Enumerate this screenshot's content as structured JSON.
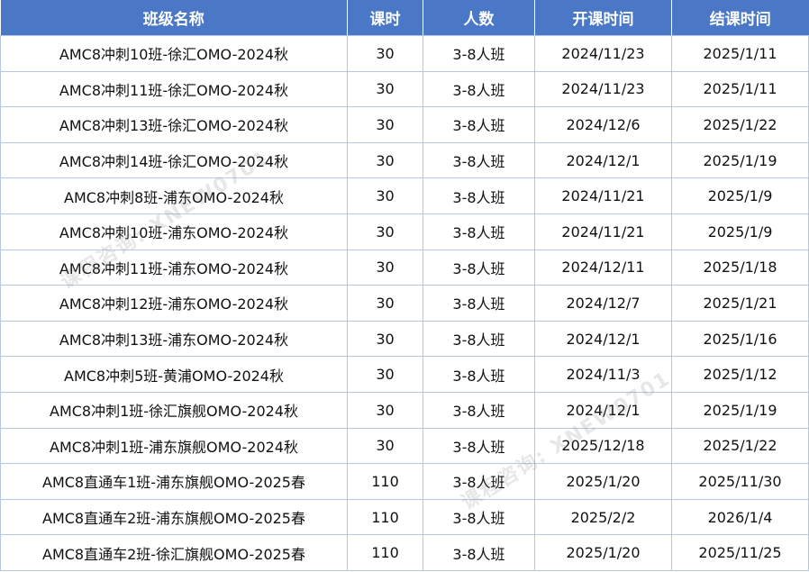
{
  "table": {
    "headers": [
      "班级名称",
      "课时",
      "人数",
      "开课时间",
      "结课时间"
    ],
    "rows": [
      [
        "AMC8冲刺10班-徐汇OMO-2024秋",
        "30",
        "3-8人班",
        "2024/11/23",
        "2025/1/11"
      ],
      [
        "AMC8冲刺11班-徐汇OMO-2024秋",
        "30",
        "3-8人班",
        "2024/11/23",
        "2025/1/11"
      ],
      [
        "AMC8冲刺13班-徐汇OMO-2024秋",
        "30",
        "3-8人班",
        "2024/12/6",
        "2025/1/22"
      ],
      [
        "AMC8冲刺14班-徐汇OMO-2024秋",
        "30",
        "3-8人班",
        "2024/12/1",
        "2025/1/19"
      ],
      [
        "AMC8冲刺8班-浦东OMO-2024秋",
        "30",
        "3-8人班",
        "2024/11/21",
        "2025/1/9"
      ],
      [
        "AMC8冲刺10班-浦东OMO-2024秋",
        "30",
        "3-8人班",
        "2024/11/21",
        "2025/1/9"
      ],
      [
        "AMC8冲刺11班-浦东OMO-2024秋",
        "30",
        "3-8人班",
        "2024/12/11",
        "2025/1/18"
      ],
      [
        "AMC8冲刺12班-浦东OMO-2024秋",
        "30",
        "3-8人班",
        "2024/12/7",
        "2025/1/21"
      ],
      [
        "AMC8冲刺13班-浦东OMO-2024秋",
        "30",
        "3-8人班",
        "2024/12/1",
        "2025/1/16"
      ],
      [
        "AMC8冲刺5班-黄浦OMO-2024秋",
        "30",
        "3-8人班",
        "2024/11/3",
        "2025/1/12"
      ],
      [
        "AMC8冲刺1班-徐汇旗舰OMO-2024秋",
        "30",
        "3-8人班",
        "2024/12/1",
        "2025/1/19"
      ],
      [
        "AMC8冲刺1班-浦东旗舰OMO-2024秋",
        "30",
        "3-8人班",
        "2025/12/18",
        "2025/1/22"
      ],
      [
        "AMC8直通车1班-浦东旗舰OMO-2025春",
        "110",
        "3-8人班",
        "2025/1/20",
        "2025/11/30"
      ],
      [
        "AMC8直通车2班-浦东旗舰OMO-2025春",
        "110",
        "3-8人班",
        "2025/2/2",
        "2026/1/4"
      ],
      [
        "AMC8直通车2班-徐汇旗舰OMO-2025春",
        "110",
        "3-8人班",
        "2025/1/20",
        "2025/11/25"
      ]
    ]
  },
  "watermarks": {
    "upper": "课程咨询: XNEW0701",
    "lower": "课程咨询: XNEW0701"
  }
}
